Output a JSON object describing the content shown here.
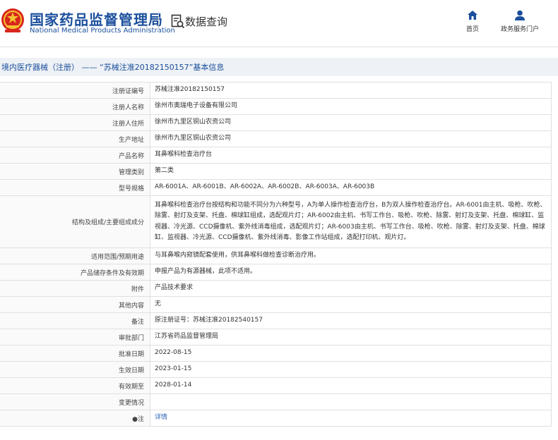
{
  "header": {
    "brand_cn": "国家药品监督管理局",
    "brand_en": "National Medical Products Administration",
    "query_label": "数据查询",
    "nav": {
      "home": "首页",
      "service": "政务服务门户"
    }
  },
  "breadcrumb": {
    "section": "境内医疗器械（注册）",
    "separator": "——",
    "title": "“苏械注准20182150157”基本信息"
  },
  "fields": [
    {
      "label": "注册证编号",
      "value": "苏械注准20182150157"
    },
    {
      "label": "注册人名称",
      "value": "徐州市奥瑞电子设备有限公司"
    },
    {
      "label": "注册人住所",
      "value": "徐州市九里区铜山农资公司"
    },
    {
      "label": "生产地址",
      "value": "徐州市九里区铜山农资公司"
    },
    {
      "label": "产品名称",
      "value": "耳鼻喉科检查治疗台"
    },
    {
      "label": "管理类别",
      "value": "第二类"
    },
    {
      "label": "型号规格",
      "value": "AR-6001A、AR-6001B、AR-6002A、AR-6002B、AR-6003A、AR-6003B"
    },
    {
      "label": "结构及组成/主要组成成分",
      "value": "耳鼻喉科检查治疗台按结构和功能不同分为六种型号，A为单人操作检查治疗台，B为双人操作检查治疗台。AR-6001由主机、吸枪、吹枪、除雾、射灯及支架、托盘、棉球缸组成，选配观片灯；AR-6002由主机、书写工作台、吸枪、吹枪、除雾、射灯及支架、托盘、棉球缸、监视器、冷光源、CCD摄像机、紫外线消毒组成，选配观片灯；AR-6003由主机、书写工作台、吸枪、吹枪、除雾、射灯及支架、托盘、棉球缸、监视器、冷光源、CCD摄像机、紫外线消毒、影像工作站组成，选配打印机、观片灯。"
    },
    {
      "label": "适用范围/预期用途",
      "value": "与耳鼻喉内窥镜配套使用，供耳鼻喉科做检查诊断治疗用。"
    },
    {
      "label": "产品储存条件及有效期",
      "value": "申报产品为有源器械，此项不适用。"
    },
    {
      "label": "附件",
      "value": "产品技术要求"
    },
    {
      "label": "其他内容",
      "value": "无"
    },
    {
      "label": "备注",
      "value": "原注册证号：苏械注准20182540157"
    },
    {
      "label": "审批部门",
      "value": "江苏省药品监督管理局"
    },
    {
      "label": "批准日期",
      "value": "2022-08-15"
    },
    {
      "label": "生效日期",
      "value": "2023-01-15"
    },
    {
      "label": "有效期至",
      "value": "2028-01-14"
    },
    {
      "label": "变更情况",
      "value": ""
    },
    {
      "label": "注",
      "value": "详情"
    }
  ],
  "colors": {
    "brand_blue": "#1b4f9c",
    "link_blue": "#2a63b5"
  },
  "icons": [
    "emblem-logo",
    "search-document-icon",
    "home-icon",
    "user-icon",
    "pin-icon"
  ]
}
